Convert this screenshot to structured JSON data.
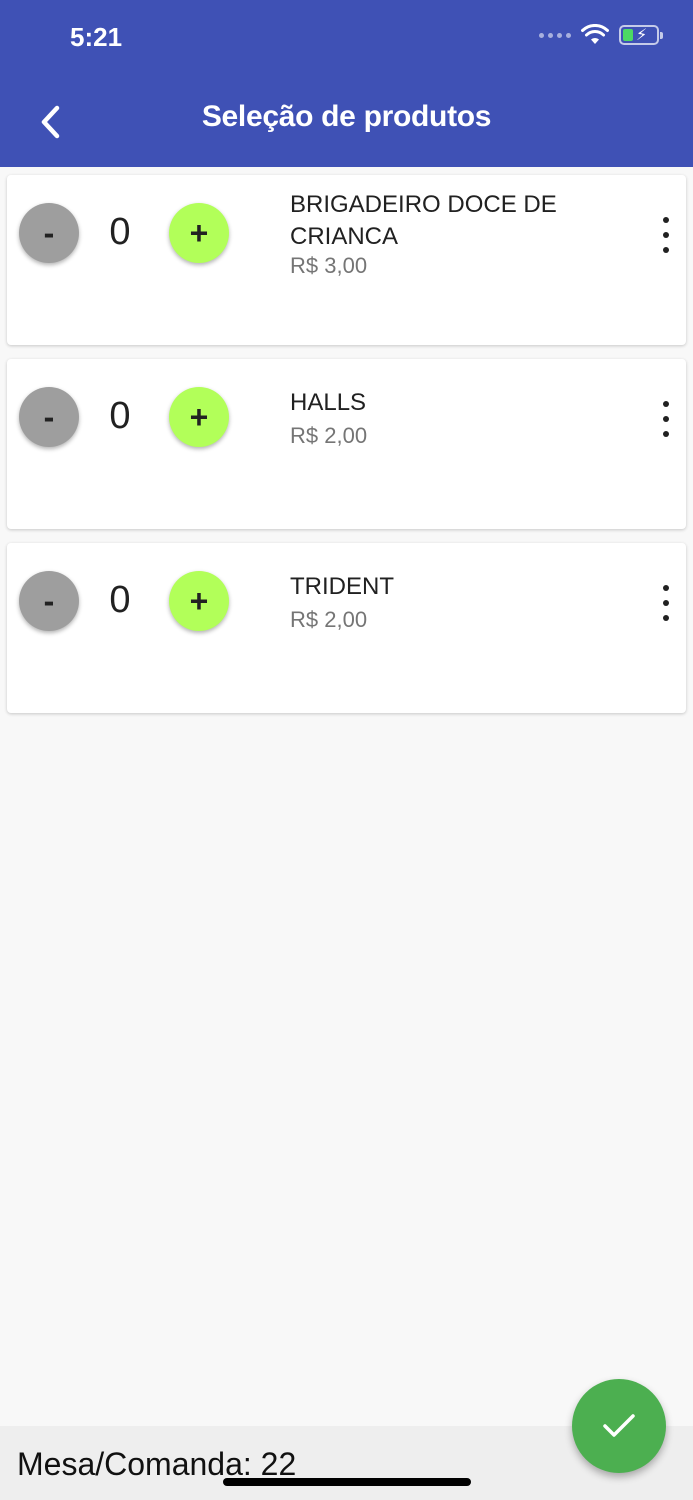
{
  "status_bar": {
    "time": "5:21"
  },
  "header": {
    "title": "Seleção de produtos",
    "back_icon": "chevron-left-icon"
  },
  "products": [
    {
      "name": "BRIGADEIRO DOCE DE CRIANCA",
      "price": "R$ 3,00",
      "quantity": "0",
      "minus_label": "-",
      "plus_label": "+"
    },
    {
      "name": "HALLS",
      "price": "R$ 2,00",
      "quantity": "0",
      "minus_label": "-",
      "plus_label": "+"
    },
    {
      "name": "TRIDENT",
      "price": "R$ 2,00",
      "quantity": "0",
      "minus_label": "-",
      "plus_label": "+"
    }
  ],
  "footer": {
    "mesa_label": "Mesa/Comanda: 22"
  },
  "fab": {
    "icon": "check-icon"
  },
  "colors": {
    "header": "#3f51b5",
    "plus_button": "#b2ff59",
    "minus_button": "#9e9e9e",
    "fab": "#4caf50"
  }
}
